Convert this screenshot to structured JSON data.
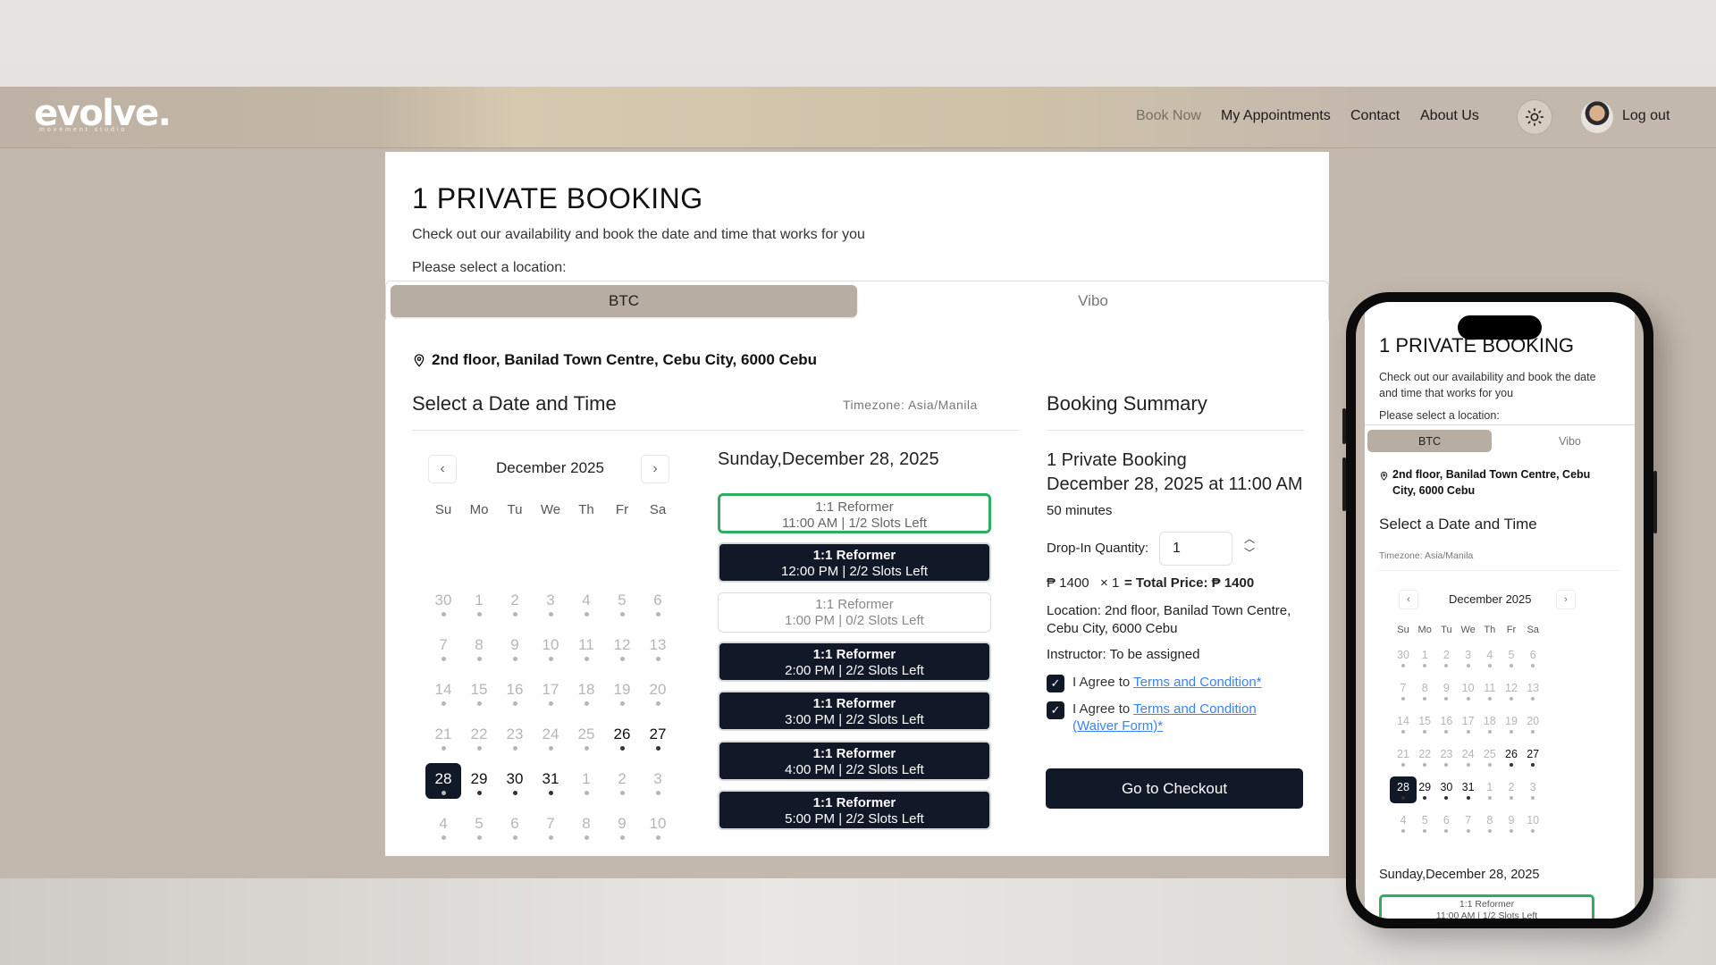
{
  "brand": {
    "logo": "evolve.",
    "tagline": "movement studio"
  },
  "nav": {
    "book_now": "Book Now",
    "my_appointments": "My Appointments",
    "contact": "Contact",
    "about_us": "About Us",
    "logout": "Log out"
  },
  "page": {
    "title": "1 PRIVATE BOOKING",
    "subtitle": "Check out our availability and book the date and time that works for you",
    "location_label": "Please select a location:",
    "locations": [
      "BTC",
      "Vibo"
    ],
    "selected_location": "BTC",
    "address": "2nd floor, Banilad Town Centre, Cebu City, 6000 Cebu"
  },
  "calendar": {
    "section_title": "Select a Date and Time",
    "timezone": "Timezone: Asia/Manila",
    "month_label": "December 2025",
    "prev_icon": "chevron-left-icon",
    "next_icon": "chevron-right-icon",
    "weekdays": [
      "Su",
      "Mo",
      "Tu",
      "We",
      "Th",
      "Fr",
      "Sa"
    ],
    "weeks": [
      [
        "30",
        "1",
        "2",
        "3",
        "4",
        "5",
        "6"
      ],
      [
        "7",
        "8",
        "9",
        "10",
        "11",
        "12",
        "13"
      ],
      [
        "14",
        "15",
        "16",
        "17",
        "18",
        "19",
        "20"
      ],
      [
        "21",
        "22",
        "23",
        "24",
        "25",
        "26",
        "27"
      ],
      [
        "28",
        "29",
        "30",
        "31",
        "1",
        "2",
        "3"
      ],
      [
        "4",
        "5",
        "6",
        "7",
        "8",
        "9",
        "10"
      ]
    ],
    "available_days": [
      "26",
      "27",
      "28",
      "29",
      "30",
      "31"
    ],
    "selected_day": "28"
  },
  "slots": {
    "date_heading": "Sunday,December 28, 2025",
    "items": [
      {
        "name": "1:1 Reformer",
        "detail": "11:00 AM | 1/2 Slots Left",
        "state": "selected"
      },
      {
        "name": "1:1 Reformer",
        "detail": "12:00 PM | 2/2 Slots Left",
        "state": "open"
      },
      {
        "name": "1:1 Reformer",
        "detail": "1:00 PM | 0/2 Slots Left",
        "state": "full"
      },
      {
        "name": "1:1 Reformer",
        "detail": "2:00 PM | 2/2 Slots Left",
        "state": "open"
      },
      {
        "name": "1:1 Reformer",
        "detail": "3:00 PM | 2/2 Slots Left",
        "state": "open"
      },
      {
        "name": "1:1 Reformer",
        "detail": "4:00 PM | 2/2 Slots Left",
        "state": "open"
      },
      {
        "name": "1:1 Reformer",
        "detail": "5:00 PM | 2/2 Slots Left",
        "state": "open"
      }
    ]
  },
  "summary": {
    "title": "Booking Summary",
    "booking_name": "1 Private Booking",
    "datetime": "December 28, 2025 at 11:00 AM",
    "duration": "50 minutes",
    "quantity_label": "Drop-In Quantity:",
    "quantity_value": "1",
    "price_line": "₱ 1400   × 1",
    "total_price": "= Total Price: ₱ 1400",
    "location_line": "Location: 2nd floor, Banilad Town Centre, Cebu City, 6000 Cebu",
    "instructor_line": "Instructor: To be assigned",
    "agree_prefix": "I Agree to ",
    "agree_1_link": "Terms and Condition*",
    "agree_2_link": "Terms and Condition (Waiver Form)*",
    "checkbox_mark": "✓",
    "checkout_label": "Go to Checkout"
  },
  "mobile": {
    "title": "1 PRIVATE BOOKING",
    "subtitle": "Check out our availability and book the date and time that works for you",
    "location_label": "Please select a location:",
    "tabs": [
      "BTC",
      "Vibo"
    ],
    "address": "2nd floor, Banilad Town Centre, Cebu City, 6000 Cebu",
    "section_title": "Select a Date and Time",
    "timezone": "Timezone: Asia/Manila",
    "month_label": "December 2025",
    "date_heading": "Sunday,December 28, 2025",
    "first_slot_name": "1:1 Reformer",
    "first_slot_detail": "11:00 AM | 1/2 Slots Left"
  },
  "colors": {
    "accent_dark": "#111827",
    "selected_tab": "#b7ada2",
    "selected_slot_border": "#2fae60",
    "link": "#3b82f6",
    "site_bg": "#c3b8ad"
  }
}
